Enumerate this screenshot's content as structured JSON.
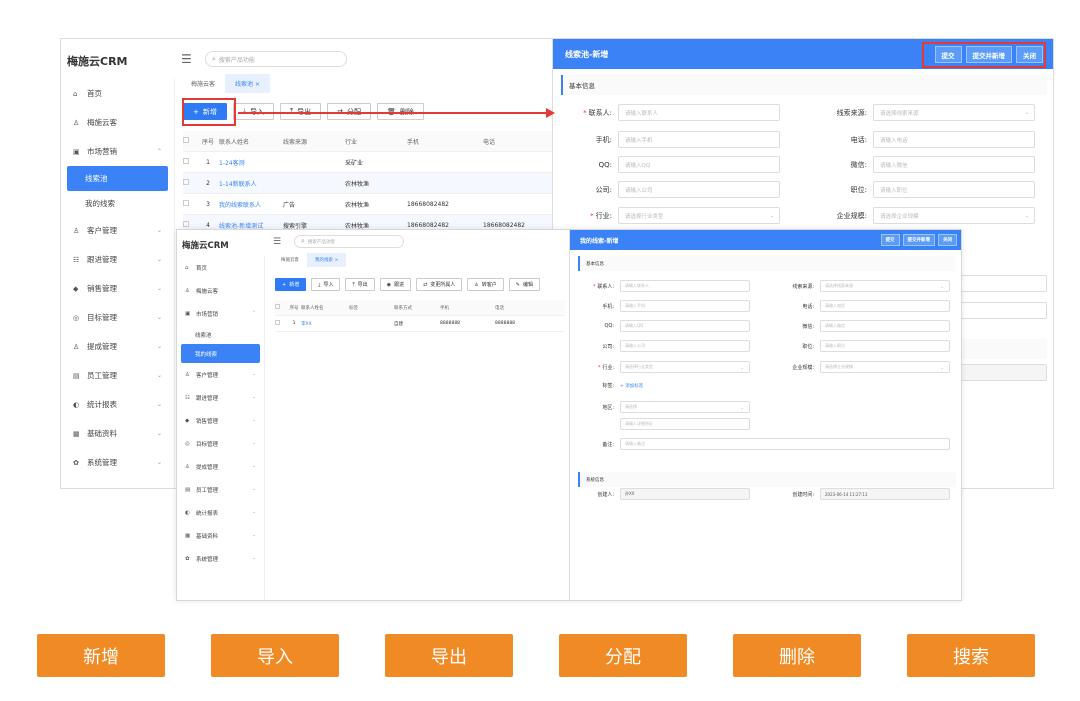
{
  "back": {
    "app_title": "梅施云CRM",
    "search_placeholder": "搜索产品功能",
    "tabs": [
      "梅施云客",
      "线索池"
    ],
    "sidebar": {
      "items": [
        {
          "label": "首页",
          "icon": "home-icon",
          "glyph": "⌂"
        },
        {
          "label": "梅施云客",
          "icon": "person-icon",
          "glyph": "♙"
        },
        {
          "label": "市场营销",
          "icon": "briefcase-icon",
          "glyph": "▣",
          "chevron": "⌃"
        }
      ],
      "sub": [
        {
          "label": "线索池",
          "active": true
        },
        {
          "label": "我的线索",
          "active": false
        }
      ],
      "more": [
        {
          "label": "客户管理",
          "icon": "people-icon",
          "glyph": "♙"
        },
        {
          "label": "跟进管理",
          "icon": "chat-icon",
          "glyph": "☷"
        },
        {
          "label": "销售管理",
          "icon": "tag-icon",
          "glyph": "◆"
        },
        {
          "label": "目标管理",
          "icon": "target-icon",
          "glyph": "◎"
        },
        {
          "label": "提成管理",
          "icon": "group-icon",
          "glyph": "♙"
        },
        {
          "label": "员工管理",
          "icon": "id-card-icon",
          "glyph": "▤"
        },
        {
          "label": "统计报表",
          "icon": "chart-icon",
          "glyph": "◐"
        },
        {
          "label": "基础资料",
          "icon": "database-icon",
          "glyph": "▦"
        },
        {
          "label": "系统管理",
          "icon": "gear-icon",
          "glyph": "✿"
        }
      ]
    },
    "toolbar": {
      "add": "新增",
      "import": "导入",
      "export": "导出",
      "assign": "分配",
      "delete": "删除"
    },
    "table": {
      "headers": [
        "序号",
        "联系人姓名",
        "线索来源",
        "行业",
        "手机",
        "电话"
      ],
      "rows": [
        [
          "1",
          "1-24客测",
          "",
          "采矿业",
          "",
          ""
        ],
        [
          "2",
          "1-14新联系人",
          "",
          "农林牧渔",
          "",
          ""
        ],
        [
          "3",
          "我的线索联系人",
          "广告",
          "农林牧渔",
          "18668082482",
          ""
        ],
        [
          "4",
          "线索池-新增测试",
          "搜索引擎",
          "农林牧渔",
          "18668082482",
          "18668082482"
        ]
      ]
    },
    "panel": {
      "title": "线索池-新增",
      "buttons": [
        "提交",
        "提交并新增",
        "关闭"
      ],
      "section_basic": "基本信息",
      "fields": {
        "contact": {
          "label": "联系人:",
          "placeholder": "请输入联系人"
        },
        "source": {
          "label": "线索来源:",
          "placeholder": "请选择线索来源"
        },
        "mobile": {
          "label": "手机:",
          "placeholder": "请输入手机"
        },
        "phone": {
          "label": "电话:",
          "placeholder": "请输入电话"
        },
        "qq": {
          "label": "QQ:",
          "placeholder": "请输入QQ"
        },
        "wechat": {
          "label": "微信:",
          "placeholder": "请输入微信"
        },
        "company": {
          "label": "公司:",
          "placeholder": "请输入公司"
        },
        "position": {
          "label": "职位:",
          "placeholder": "请输入职位"
        },
        "industry": {
          "label": "行业:",
          "placeholder": "请选择行业类型"
        },
        "scale": {
          "label": "企业规模:",
          "placeholder": "请选择企业规模"
        }
      }
    }
  },
  "front": {
    "app_title": "梅施云CRM",
    "search_placeholder": "搜索产品功能",
    "tabs": [
      "梅施云客",
      "我的线索"
    ],
    "sidebar": {
      "items": [
        {
          "label": "首页",
          "glyph": "⌂"
        },
        {
          "label": "梅施云客",
          "glyph": "♙"
        },
        {
          "label": "市场营销",
          "glyph": "▣",
          "chevron": "⌃"
        }
      ],
      "sub": [
        {
          "label": "线索池",
          "active": false
        },
        {
          "label": "我的线索",
          "active": true
        }
      ],
      "more": [
        {
          "label": "客户管理",
          "glyph": "♙"
        },
        {
          "label": "跟进管理",
          "glyph": "☷"
        },
        {
          "label": "销售管理",
          "glyph": "◆"
        },
        {
          "label": "目标管理",
          "glyph": "◎"
        },
        {
          "label": "提成管理",
          "glyph": "♙"
        },
        {
          "label": "员工管理",
          "glyph": "▤"
        },
        {
          "label": "统计报表",
          "glyph": "◐"
        },
        {
          "label": "基础资料",
          "glyph": "▦"
        },
        {
          "label": "系统管理",
          "glyph": "✿"
        }
      ]
    },
    "toolbar": {
      "add": "新增",
      "import": "导入",
      "export": "导出",
      "follow": "跟进",
      "change_owner": "变更所属人",
      "to_customer": "转客户",
      "edit": "编辑"
    },
    "table": {
      "headers": [
        "序号",
        "联系人姓名",
        "标签",
        "联系方式",
        "手机",
        "电话"
      ],
      "rows": [
        [
          "1",
          "李XX",
          "",
          "自建",
          "8888888",
          "8888888"
        ]
      ]
    },
    "panel": {
      "title": "我的线索-新增",
      "buttons": [
        "提交",
        "提交并新增",
        "关闭"
      ],
      "section_basic": "基本信息",
      "section_system": "系统信息",
      "tag_label": "标签:",
      "add_tag": "+ 添加标签",
      "area_label": "地区:",
      "area_placeholder": "请选择",
      "address_placeholder": "请输入详细地址",
      "remark_label": "备注:",
      "remark_placeholder": "请输入备注",
      "creator_label": "创建人:",
      "creator_value": "孙XX",
      "created_label": "创建时间:",
      "created_value": "2023-06-14 11:27:11"
    }
  },
  "features": [
    "新增",
    "导入",
    "导出",
    "分配",
    "删除",
    "搜索"
  ]
}
